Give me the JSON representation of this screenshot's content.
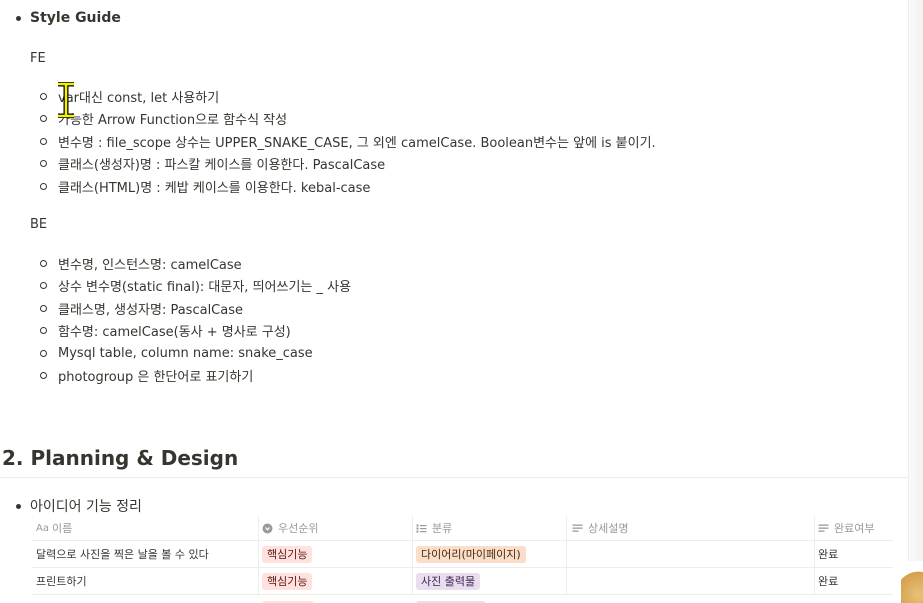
{
  "style_guide": {
    "title": "Style Guide",
    "fe": {
      "label": "FE",
      "items": [
        "var대신 const, let 사용하기",
        "가능한 Arrow Function으로 함수식 작성",
        "변수명 : file_scope 상수는 UPPER_SNAKE_CASE, 그 외엔 camelCase. Boolean변수는 앞에 is 붙이기.",
        "클래스(생성자)명 : 파스칼 케이스를 이용한다. PascalCase",
        "클래스(HTML)명 : 케밥 케이스를 이용한다. kebal-case"
      ]
    },
    "be": {
      "label": "BE",
      "items": [
        "변수명, 인스턴스명: camelCase",
        "상수 변수명(static final): 대문자, 띄어쓰기는 _ 사용",
        "클래스명, 생성자명: PascalCase",
        "함수명: camelCase(동사 + 명사로 구성)",
        "Mysql table, column name: snake_case",
        "photogroup 은 한단어로 표기하기"
      ]
    }
  },
  "section": {
    "heading": "2. Planning & Design",
    "ideas_label": "아이디어 기능 정리"
  },
  "table": {
    "columns": [
      {
        "label": "이름",
        "icon": "Aa"
      },
      {
        "label": "우선순위",
        "icon": "select-icon"
      },
      {
        "label": "분류",
        "icon": "multi-select-icon"
      },
      {
        "label": "상세설명",
        "icon": "text-icon"
      },
      {
        "label": "완료여부",
        "icon": "text-icon"
      }
    ],
    "rows": [
      {
        "name": "달력으로 사진을 찍은 날을 볼 수 있다",
        "priority": "핵심기능",
        "category": "다이어리(마이페이지)",
        "detail": "",
        "status": "완료"
      },
      {
        "name": "프린트하기",
        "priority": "핵심기능",
        "category": "사진 출력물",
        "detail": "",
        "status": "완료"
      }
    ]
  },
  "colors": {
    "tag_priority_bg": "#ffe2dd",
    "tag_category_diary_bg": "#fadec9",
    "tag_category_print_bg": "#e8deee",
    "text": "#37352f",
    "muted": "#9b9a97"
  }
}
